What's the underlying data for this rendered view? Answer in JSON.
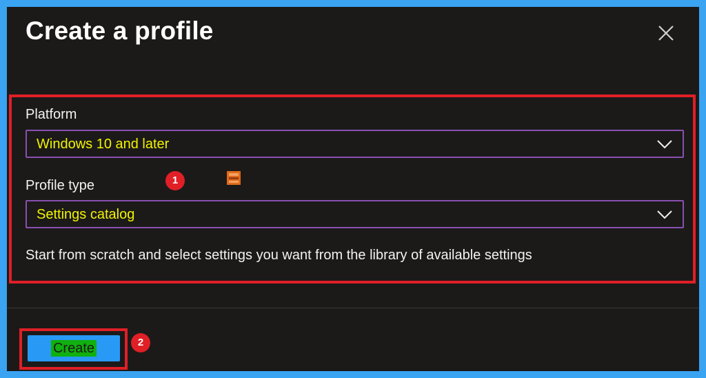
{
  "dialog": {
    "title": "Create a profile",
    "close_icon": "close-icon"
  },
  "form": {
    "platform": {
      "label": "Platform",
      "value": "Windows 10 and later"
    },
    "profile_type": {
      "label": "Profile type",
      "value": "Settings catalog"
    },
    "description": "Start from scratch and select settings you want from the library of available settings"
  },
  "footer": {
    "create_label": "Create"
  },
  "callouts": [
    "1",
    "2"
  ],
  "colors": {
    "background": "#1b1a19",
    "frame": "#3aa3f2",
    "highlight": "#e01f26",
    "dropdown_border": "#8a4fb0",
    "dropdown_text": "#f3f300",
    "primary_button": "#2899f5",
    "button_text_highlight": "#0fb00f"
  }
}
